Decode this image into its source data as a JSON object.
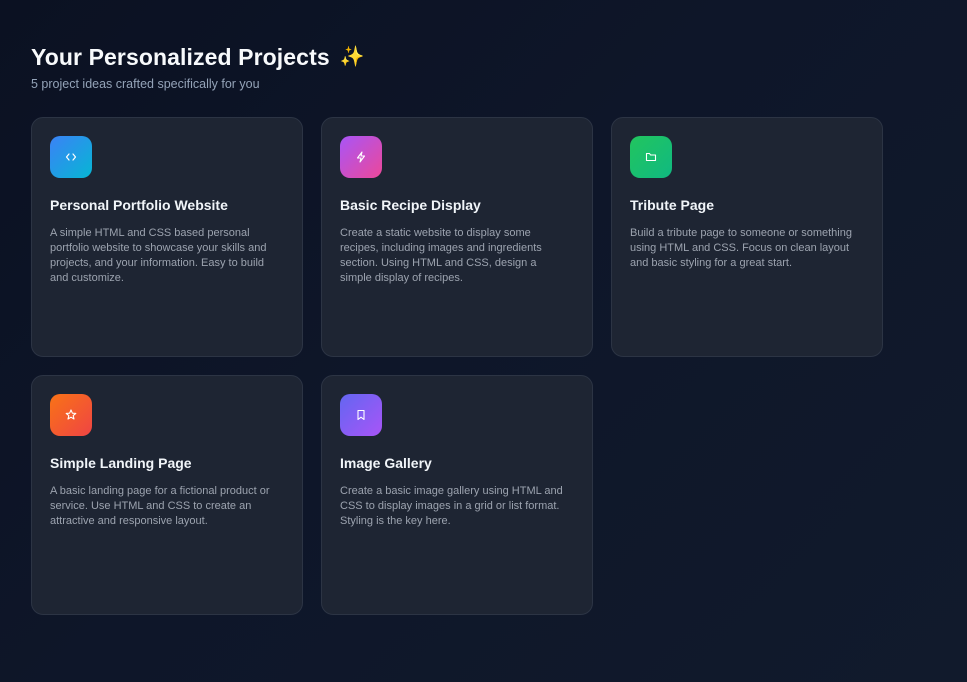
{
  "header": {
    "title": "Your Personalized Projects",
    "sparkle": "✨",
    "subtitle": "5 project ideas crafted specifically for you"
  },
  "projects": [
    {
      "title": "Personal Portfolio Website",
      "description": "A simple HTML and CSS based personal portfolio website to showcase your skills and projects, and your information. Easy to build and customize.",
      "icon": "code-icon",
      "gradient": [
        "#3b82f6",
        "#06b6d4"
      ]
    },
    {
      "title": "Basic Recipe Display",
      "description": "Create a static website to display some recipes, including images and ingredients section. Using HTML and CSS, design a simple display of recipes.",
      "icon": "lightning-icon",
      "gradient": [
        "#a855f7",
        "#ec4899"
      ]
    },
    {
      "title": "Tribute Page",
      "description": "Build a tribute page to someone or something using HTML and CSS. Focus on clean layout and basic styling for a great start.",
      "icon": "folder-icon",
      "gradient": [
        "#22c55e",
        "#10b981"
      ]
    },
    {
      "title": "Simple Landing Page",
      "description": "A basic landing page for a fictional product or service. Use HTML and CSS to create an attractive and responsive layout.",
      "icon": "star-icon",
      "gradient": [
        "#f97316",
        "#ef4444"
      ]
    },
    {
      "title": "Image Gallery",
      "description": "Create a basic image gallery using HTML and CSS to display images in a grid or list format. Styling is the key here.",
      "icon": "bookmark-icon",
      "gradient": [
        "#6366f1",
        "#a855f7"
      ]
    }
  ]
}
